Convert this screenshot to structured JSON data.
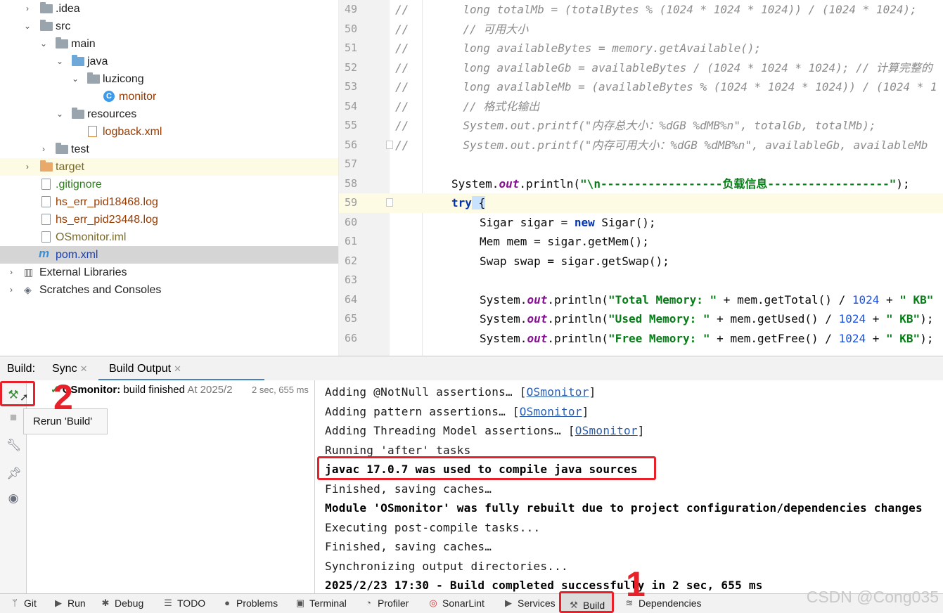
{
  "project_tree": {
    "items": [
      {
        "label": ".idea",
        "icon": "folder-icon"
      },
      {
        "label": "src",
        "icon": "folder-icon"
      },
      {
        "label": "main",
        "icon": "folder-icon"
      },
      {
        "label": "java",
        "icon": "source-folder-icon"
      },
      {
        "label": "luzicong",
        "icon": "package-icon"
      },
      {
        "label": "monitor",
        "icon": "java-class-icon"
      },
      {
        "label": "resources",
        "icon": "resources-folder-icon"
      },
      {
        "label": "logback.xml",
        "icon": "xml-file-icon"
      },
      {
        "label": "test",
        "icon": "folder-icon"
      },
      {
        "label": "target",
        "icon": "excluded-folder-icon"
      },
      {
        "label": ".gitignore",
        "icon": "ignore-file-icon"
      },
      {
        "label": "hs_err_pid18468.log",
        "icon": "log-file-icon"
      },
      {
        "label": "hs_err_pid23448.log",
        "icon": "log-file-icon"
      },
      {
        "label": "OSmonitor.iml",
        "icon": "iml-file-icon"
      },
      {
        "label": "pom.xml",
        "icon": "maven-icon"
      },
      {
        "label": "External Libraries",
        "icon": "libraries-icon"
      },
      {
        "label": "Scratches and Consoles",
        "icon": "scratches-icon"
      }
    ]
  },
  "editor": {
    "lines": [
      {
        "n": "49",
        "text": "//        long totalMb = (totalBytes % (1024 * 1024 * 1024)) / (1024 * 1024);"
      },
      {
        "n": "50",
        "text": "//        // 可用大小"
      },
      {
        "n": "51",
        "text": "//        long availableBytes = memory.getAvailable();"
      },
      {
        "n": "52",
        "text": "//        long availableGb = availableBytes / (1024 * 1024 * 1024); // 计算完整的"
      },
      {
        "n": "53",
        "text": "//        long availableMb = (availableBytes % (1024 * 1024 * 1024)) / (1024 * 1"
      },
      {
        "n": "54",
        "text": "//        // 格式化输出"
      },
      {
        "n": "55",
        "text": "//        System.out.printf(\"内存总大小：%dGB %dMB%n\", totalGb, totalMb);"
      },
      {
        "n": "56",
        "text": "//        System.out.printf(\"内存可用大小：%dGB %dMB%n\", availableGb, availableMb"
      },
      {
        "n": "57",
        "text": ""
      },
      {
        "n": "58",
        "text_parts": [
          "System.",
          "out",
          ".println(",
          "\"\\n------------------负载信息------------------\"",
          ");"
        ]
      },
      {
        "n": "59",
        "text_parts": [
          "try",
          " {"
        ]
      },
      {
        "n": "60",
        "text_parts": [
          "Sigar sigar = ",
          "new",
          " Sigar();"
        ]
      },
      {
        "n": "61",
        "text": "Mem mem = sigar.getMem();"
      },
      {
        "n": "62",
        "text": "Swap swap = sigar.getSwap();"
      },
      {
        "n": "63",
        "text": ""
      },
      {
        "n": "64",
        "text_parts": [
          "System.",
          "out",
          ".println(",
          "\"Total Memory: \"",
          " + mem.getTotal() / ",
          "1024",
          " + ",
          "\" KB\""
        ]
      },
      {
        "n": "65",
        "text_parts": [
          "System.",
          "out",
          ".println(",
          "\"Used Memory: \"",
          " + mem.getUsed() / ",
          "1024",
          " + ",
          "\" KB\"",
          ");"
        ]
      },
      {
        "n": "66",
        "text_parts": [
          "System.",
          "out",
          ".println(",
          "\"Free Memory: \"",
          " + mem.getFree() / ",
          "1024",
          " + ",
          "\" KB\"",
          ");"
        ]
      }
    ]
  },
  "build_window": {
    "title": "Build:",
    "tabs": [
      {
        "label": "Sync"
      },
      {
        "label": "Build Output"
      }
    ],
    "build_item": {
      "name": "OSmonitor:",
      "status": "build finished",
      "time": "At 2025/2",
      "duration": "2 sec, 655 ms"
    },
    "tooltip": "Rerun 'Build'",
    "console": [
      {
        "pre": "Adding @NotNull assertions… [",
        "link": "OSmonitor",
        "post": "]"
      },
      {
        "pre": "Adding pattern assertions… [",
        "link": "OSmonitor",
        "post": "]"
      },
      {
        "pre": "Adding Threading Model assertions… [",
        "link": "OSmonitor",
        "post": "]"
      },
      {
        "pre": "Running 'after' tasks"
      },
      {
        "pre": "javac 17.0.7 was used to compile java sources",
        "bold": true
      },
      {
        "pre": "Finished, saving caches…"
      },
      {
        "pre": "Module 'OSmonitor' was fully rebuilt due to project configuration/dependencies changes",
        "bold": true
      },
      {
        "pre": "Executing post-compile tasks..."
      },
      {
        "pre": "Finished, saving caches…"
      },
      {
        "pre": "Synchronizing output directories..."
      },
      {
        "pre": "2025/2/23 17:30 - Build completed successfully in 2 sec, 655 ms",
        "bold": true
      }
    ]
  },
  "statusbar": {
    "items": [
      {
        "label": "Git",
        "icon": "git-icon"
      },
      {
        "label": "Run",
        "icon": "run-icon"
      },
      {
        "label": "Debug",
        "icon": "debug-icon"
      },
      {
        "label": "TODO",
        "icon": "todo-icon"
      },
      {
        "label": "Problems",
        "icon": "problems-icon"
      },
      {
        "label": "Terminal",
        "icon": "terminal-icon"
      },
      {
        "label": "Profiler",
        "icon": "profiler-icon"
      },
      {
        "label": "SonarLint",
        "icon": "sonarlint-icon"
      },
      {
        "label": "Services",
        "icon": "services-icon"
      },
      {
        "label": "Build",
        "icon": "hammer-icon"
      },
      {
        "label": "Dependencies",
        "icon": "dependencies-icon"
      }
    ]
  },
  "annotations": {
    "step1": "1",
    "step2": "2",
    "accent_color": "#e8202a"
  },
  "watermark": "CSDN @Cong035"
}
